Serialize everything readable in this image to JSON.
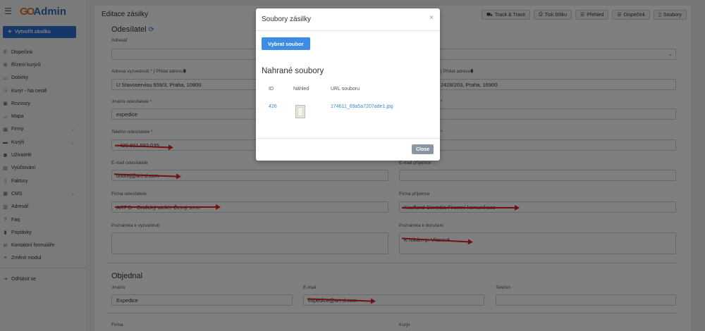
{
  "app": {
    "logo_go": "GO",
    "logo_text": "Admin"
  },
  "sidebar": {
    "create_button": "Vytvořit zásilku",
    "items": [
      {
        "label": "Dispečink",
        "icon": "megaphone-icon",
        "glyph": "✆"
      },
      {
        "label": "Řízení kurýrů",
        "icon": "sitemap-icon",
        "glyph": "⊞"
      },
      {
        "label": "Dobírky",
        "icon": "money-icon",
        "glyph": "▭"
      },
      {
        "label": "Kurýr - Na cestě",
        "icon": "users-icon",
        "glyph": "⚇"
      },
      {
        "label": "Rozvozy",
        "icon": "bus-icon",
        "glyph": "▣"
      },
      {
        "label": "Mapa",
        "icon": "map-icon",
        "glyph": "▱"
      },
      {
        "label": "Firmy",
        "icon": "building-icon",
        "glyph": "▦",
        "expandable": true
      },
      {
        "label": "Kurýři",
        "icon": "truck-icon",
        "glyph": "▬",
        "expandable": true
      },
      {
        "label": "Uživatelé",
        "icon": "user-cog-icon",
        "glyph": "⚉"
      },
      {
        "label": "Vyúčtování",
        "icon": "invoice-icon",
        "glyph": "▤"
      },
      {
        "label": "Faktury",
        "icon": "file-icon",
        "glyph": "▯"
      },
      {
        "label": "CMS",
        "icon": "folder-icon",
        "glyph": "▩",
        "expandable": true
      },
      {
        "label": "Adresář",
        "icon": "address-book-icon",
        "glyph": "▥"
      },
      {
        "label": "Faq",
        "icon": "question-icon",
        "glyph": "?"
      },
      {
        "label": "Poptávky",
        "icon": "clipboard-icon",
        "glyph": "▮"
      },
      {
        "label": "Kontaktní formuláře",
        "icon": "envelope-icon",
        "glyph": "✉"
      },
      {
        "label": "Změnit modul",
        "icon": "list-icon",
        "glyph": "≡"
      }
    ],
    "logout": "Odhlásit se"
  },
  "header": {
    "title": "Editace zásilky",
    "actions": [
      {
        "label": "Track & Trace",
        "icon": "route-icon",
        "glyph": "⛟"
      },
      {
        "label": "Tisk štítku",
        "icon": "print-icon",
        "glyph": "⎙"
      },
      {
        "label": "Přehled",
        "icon": "list-icon",
        "glyph": "☰"
      },
      {
        "label": "Dispečink",
        "icon": "list-icon",
        "glyph": "☰"
      },
      {
        "label": "Soubory",
        "icon": "file-icon",
        "glyph": "▯"
      }
    ]
  },
  "form": {
    "sender_title": "Odesílatel",
    "addressbook_label": "Adresář",
    "pickup_address_label": "Adresa vyzvednutí * [ Přidat adresu",
    "pickup_address_value": "U Stavoservisu 659/3, Praha, 10800",
    "recipient_address_label": "[ Přidat adresu",
    "recipient_address_value": "2428/203, Praha, 16900",
    "sender_name_label": "Jméno odesílatele *",
    "sender_name_value": "expedice",
    "recipient_name_label": "*",
    "sender_phone_label": "Telefon odesílatele *",
    "sender_phone_value": "+420 601 592 035",
    "recipient_phone_label": "*",
    "sender_email_label": "E-mail odesílatele",
    "sender_email_value": "ondrej@art-d.com",
    "recipient_email_label": "E-mail příjemce",
    "sender_company_label": "Firma odesílatele",
    "sender_company_value": "ART D - Grafický ateliér Černý s.r.o.",
    "recipient_company_label": "Firma příjemce",
    "recipient_company_value": "Kaufland Centrála Firemní komunikace",
    "pickup_note_label": "Poznámka k vyzvednutí",
    "delivery_note_label": "Poznámka k doručení",
    "delivery_note_value": "K rukám p. Vlasová",
    "orderer_title": "Objednal",
    "orderer_name_label": "Jméno",
    "orderer_name_value": "Expedice",
    "orderer_email_label": "E-mail",
    "orderer_email_value": "expedice@art-d.com",
    "orderer_phone_label": "Telefon",
    "company_label": "Firma",
    "courier_label": "Kurýr"
  },
  "modal": {
    "title": "Soubory zásilky",
    "choose_button": "Vybrat soubor",
    "uploaded_title": "Nahrané soubory",
    "columns": [
      "ID",
      "Náhled",
      "URL souboru"
    ],
    "rows": [
      {
        "id": "426",
        "url": "174611_69a5a7207ade1.jpg"
      }
    ],
    "close_button": "Close"
  },
  "colors": {
    "brand_blue": "#2d6fd1",
    "brand_orange": "#e0732b",
    "redaction_red": "#e82020"
  }
}
